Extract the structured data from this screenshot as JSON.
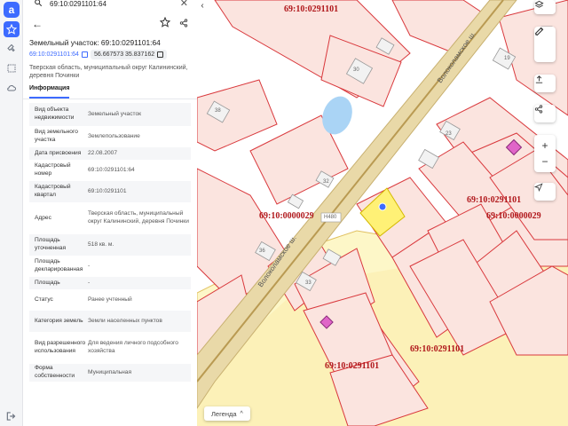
{
  "search": {
    "value": "69:10:0291101:64"
  },
  "parcel": {
    "title": "Земельный участок: 69:10:0291101:64",
    "cadastral_link": "69:10:0291101:64",
    "coords": "56.667573 35.837162",
    "address": "Тверская область, муниципальный округ Калининский, деревня Починки"
  },
  "tabs": {
    "info": "Информация"
  },
  "properties": [
    {
      "key": "Вид объекта недвижимости",
      "value": "Земельный участок"
    },
    {
      "key": "Вид земельного участка",
      "value": "Землепользование"
    },
    {
      "key": "Дата присвоения",
      "value": "22.08.2007"
    },
    {
      "key": "Кадастровый номер",
      "value": "69:10:0291101:64"
    },
    {
      "key": "Кадастровый квартал",
      "value": "69:10:0291101"
    },
    {
      "key": "Адрес",
      "value": "Тверская область, муниципальный округ Калининский, деревня Починки"
    },
    {
      "key": "Площадь уточненная",
      "value": "518 кв. м."
    },
    {
      "key": "Площадь декларированная",
      "value": "-"
    },
    {
      "key": "Площадь",
      "value": "-"
    },
    {
      "key": "Статус",
      "value": "Ранее учтенный"
    },
    {
      "key": "Категория земель",
      "value": "Земли населенных пунктов"
    },
    {
      "key": "Вид разрешенного использования",
      "value": "Для ведения личного подсобного хозяйства"
    },
    {
      "key": "Форма собственности",
      "value": "Муниципальная"
    }
  ],
  "map": {
    "labels": [
      "69:10:0291101",
      "69:10:0000029",
      "69:10:0291101",
      "69:10:0000029",
      "69:10:0291101",
      "69:10:0291101"
    ],
    "road": "Волоколамское ш.",
    "road2": "Волоколамское ш.",
    "road_code": "Н480",
    "numbers": [
      "30",
      "19",
      "38",
      "23",
      "32",
      "36",
      "33"
    ],
    "legend": "Легенда"
  },
  "colors": {
    "accent": "#3d6bff",
    "parcel_border": "#d9383c",
    "road": "#c8b070",
    "selected": "#fff176"
  }
}
